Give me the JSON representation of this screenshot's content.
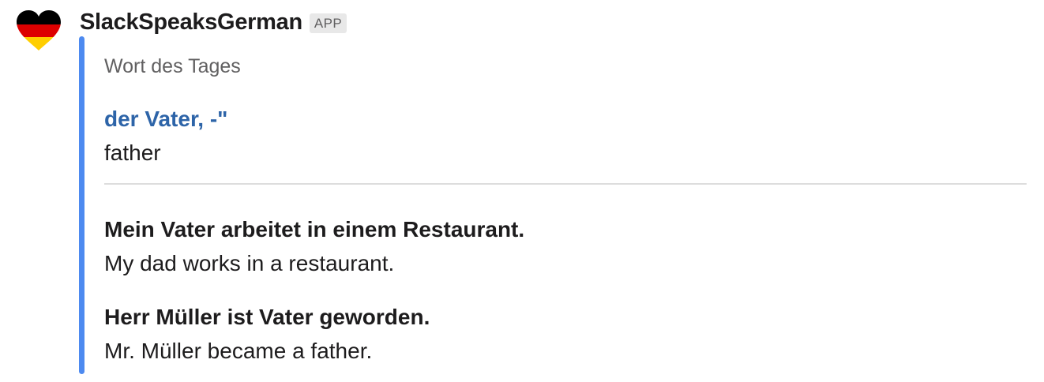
{
  "message": {
    "sender": "SlackSpeaksGerman",
    "badge": "APP",
    "avatar_icon": "german-flag-heart-icon",
    "flag_colors": [
      "#000000",
      "#dd0000",
      "#ffce00"
    ],
    "accent_color": "#4d8af0",
    "link_color": "#2d64a8"
  },
  "attachment": {
    "pretext": "Wort des Tages",
    "word": "der Vater, -\"",
    "translation": "father",
    "examples": [
      {
        "german": "Mein Vater arbeitet in einem Restaurant.",
        "english": "My dad works in a restaurant."
      },
      {
        "german": "Herr Müller ist Vater geworden.",
        "english": "Mr. Müller became a father."
      }
    ]
  }
}
